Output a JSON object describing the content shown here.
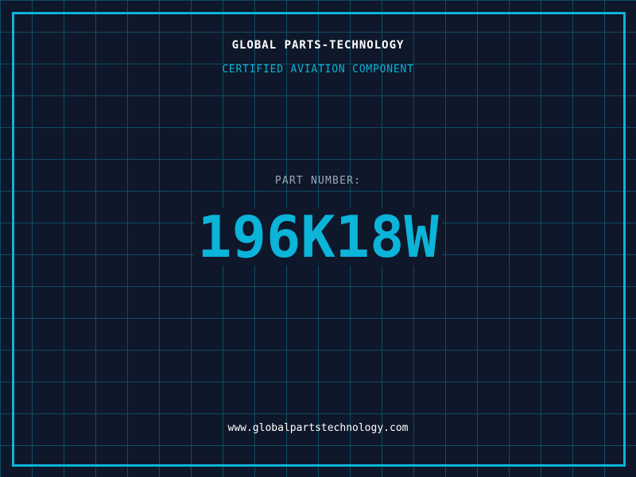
{
  "colors": {
    "background": "#0f172a",
    "grid": "#0f4c63",
    "accent": "#0bb4d8",
    "label": "#9aa8b8",
    "text": "#ffffff"
  },
  "header": {
    "title": "GLOBAL PARTS-TECHNOLOGY",
    "subtitle": "CERTIFIED AVIATION COMPONENT"
  },
  "part": {
    "label": "PART NUMBER:",
    "number": "196K18W"
  },
  "footer": {
    "url": "www.globalpartstechnology.com"
  }
}
